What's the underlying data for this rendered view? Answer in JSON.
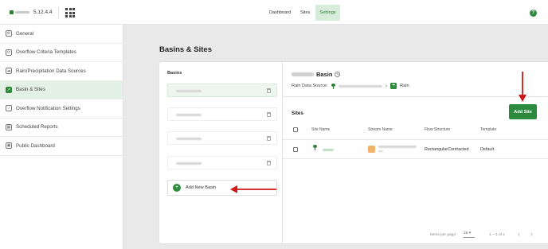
{
  "topbar": {
    "version": "5.12.4.4",
    "nav": [
      "Dashboard",
      "Sites",
      "Settings"
    ],
    "active_nav": "Settings",
    "help_label": "?"
  },
  "sidebar": {
    "items": [
      {
        "label": "General",
        "icon": "gear-icon"
      },
      {
        "label": "Overflow Criteria Templates",
        "icon": "template-icon"
      },
      {
        "label": "Rain/Precipitation Data Sources",
        "icon": "rain-icon"
      },
      {
        "label": "Basin & Sites",
        "icon": "chart-icon",
        "active": true
      },
      {
        "label": "Overflow Notification Settings",
        "icon": "bell-icon"
      },
      {
        "label": "Scheduled Reports",
        "icon": "calendar-icon"
      },
      {
        "label": "Public Dashboard",
        "icon": "dashboard-icon"
      }
    ]
  },
  "page": {
    "title": "Basins & Sites"
  },
  "basins": {
    "label": "Basins",
    "add_label": "Add New Basin",
    "add_icon": "+"
  },
  "detail": {
    "basin_word": "Basin",
    "rain_source_label": "Rain Data Source:",
    "rain_label": "Rain",
    "sites_label": "Sites",
    "add_site_label": "Add Site",
    "columns": [
      "Site Name",
      "Stream Name",
      "Flow Structure",
      "Template"
    ],
    "row": {
      "flow_structure": "RectangularContracted",
      "template": "Default"
    }
  },
  "pagination": {
    "items_per_page_label": "Items per page:",
    "items_per_page_value": "25",
    "range": "1 – 1 of 1"
  },
  "colors": {
    "accent": "#2e8b3d",
    "annotation_arrow": "#d01818"
  }
}
